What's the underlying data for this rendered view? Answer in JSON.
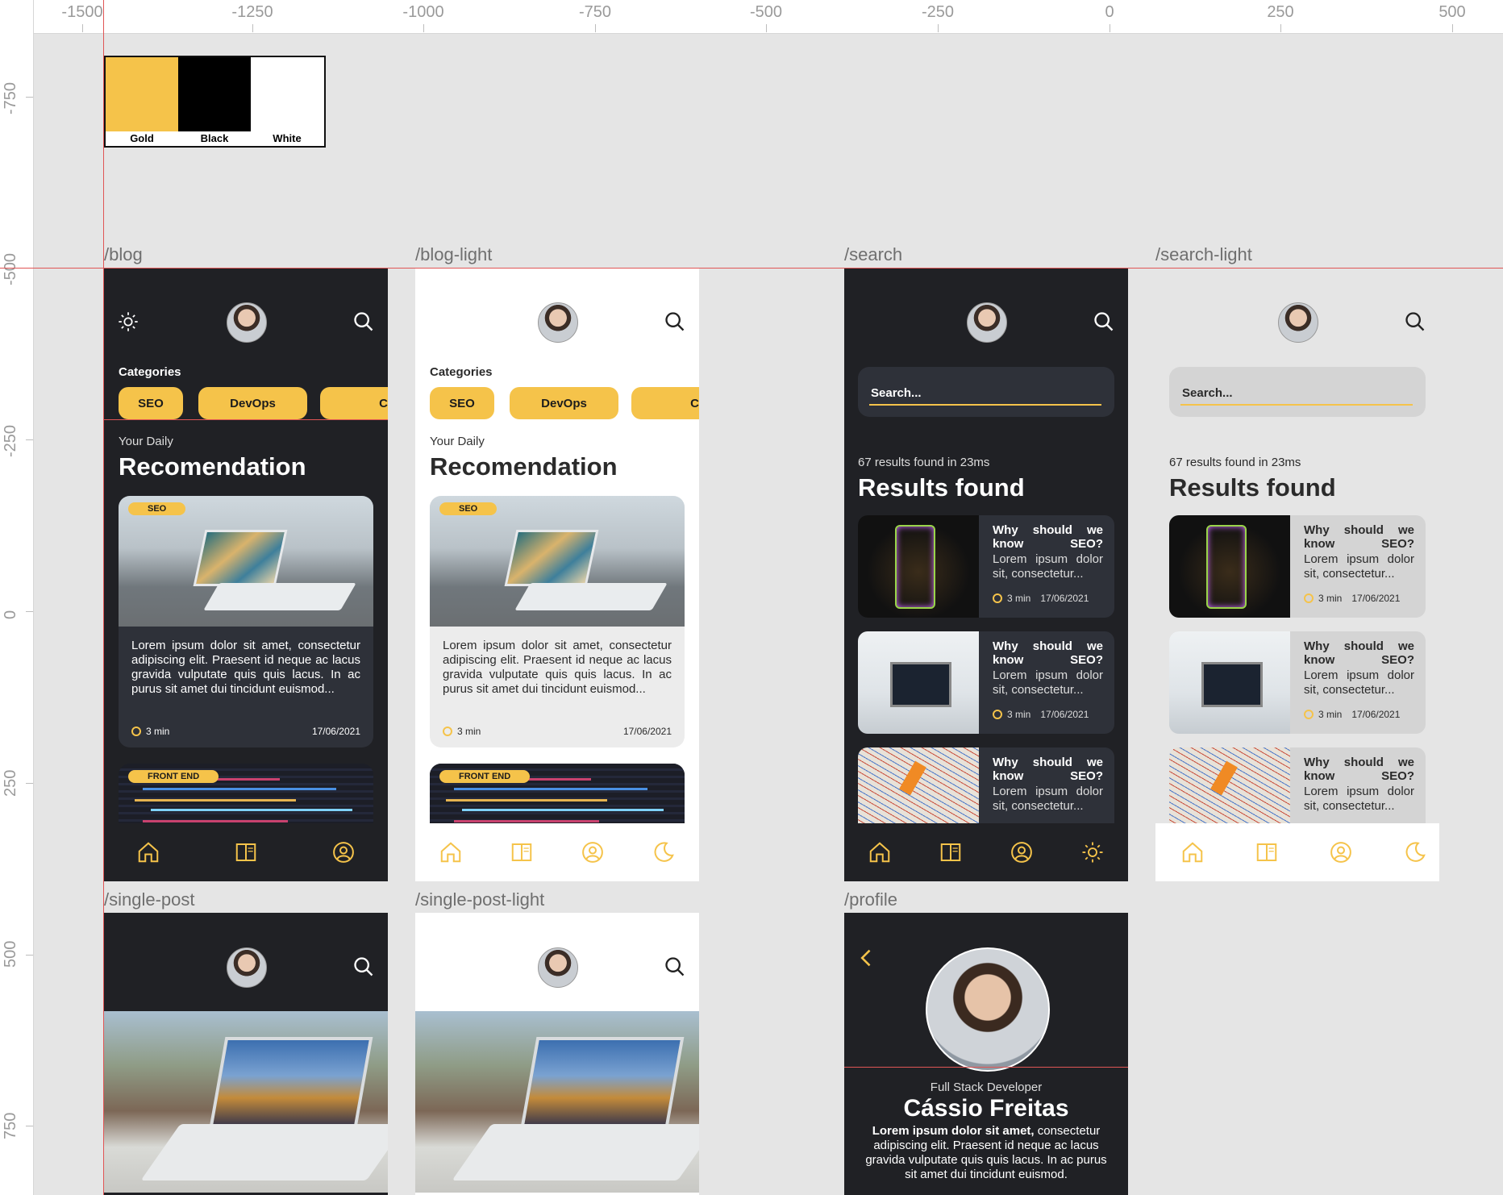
{
  "ruler": {
    "top": [
      "-1500",
      "-1250",
      "-1000",
      "-750",
      "-500",
      "-250",
      "0",
      "250",
      "500"
    ],
    "left": [
      "-750",
      "-500",
      "-250",
      "0",
      "250",
      "500",
      "750"
    ]
  },
  "palette": [
    {
      "name": "Gold",
      "color": "#f5c34a"
    },
    {
      "name": "Black",
      "color": "#000000"
    },
    {
      "name": "White",
      "color": "#ffffff"
    }
  ],
  "frames": {
    "blog": "/blog",
    "blog_light": "/blog-light",
    "search": "/search",
    "search_light": "/search-light",
    "single_post": "/single-post",
    "single_post_light": "/single-post-light",
    "profile": "/profile"
  },
  "blog": {
    "categories_label": "Categories",
    "categories": [
      "SEO",
      "DevOps",
      "CSS"
    ],
    "subtitle": "Your Daily",
    "title": "Recomendation",
    "post": {
      "tag": "SEO",
      "excerpt": "Lorem ipsum dolor sit amet, consectetur adipiscing elit. Praesent id neque ac lacus gravida vulputate quis quis lacus. In ac purus sit amet dui tincidunt euismod...",
      "read_time": "3 min",
      "date": "17/06/2021"
    },
    "post2_tag": "FRONT END"
  },
  "search": {
    "placeholder": "Search...",
    "count": "67 results found in 23ms",
    "title": "Results found",
    "result": {
      "title": "Why should we know SEO?",
      "excerpt": "Lorem ipsum dolor sit, consectetur...",
      "read_time": "3 min",
      "date": "17/06/2021"
    }
  },
  "profile": {
    "role": "Full Stack Developer",
    "name": "Cássio Freitas",
    "bio_bold": "Lorem ipsum dolor sit amet,",
    "bio": "consectetur adipiscing elit. Praesent id neque ac lacus gravida vulputate quis quis lacus. In ac purus sit amet dui tincidunt euismod."
  },
  "colors": {
    "accent": "#f5c34a",
    "dark_bg": "#202125",
    "card_dark": "#2e3139",
    "guide": "#e05555"
  },
  "icons": [
    "sun-icon",
    "search-icon",
    "home-icon",
    "book-icon",
    "user-icon",
    "moon-icon",
    "back-chevron-icon",
    "clock-icon"
  ]
}
